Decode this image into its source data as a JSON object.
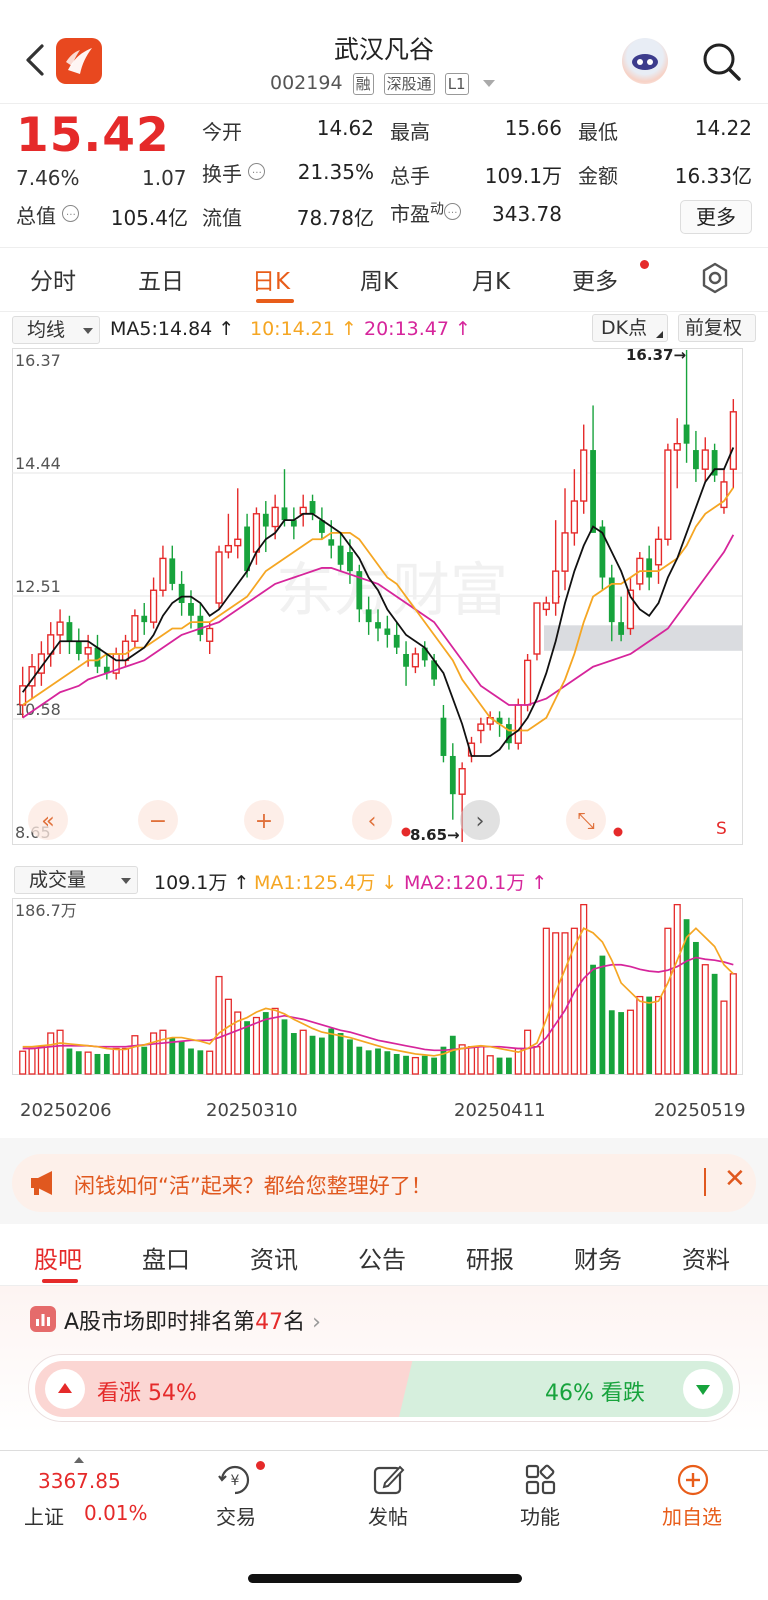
{
  "header": {
    "title": "武汉凡谷",
    "code": "002194",
    "tags": [
      "融",
      "深股通",
      "L1"
    ],
    "icons": {
      "back": "back-arrow-icon",
      "logo": "app-logo-icon",
      "robot": "ai-robot-icon",
      "search": "search-icon"
    }
  },
  "quote": {
    "price": "15.42",
    "change_pct": "7.46%",
    "change": "1.07",
    "open_label": "今开",
    "open": "14.62",
    "high_label": "最高",
    "high": "15.66",
    "low_label": "最低",
    "low": "14.22",
    "turnover_label": "换手",
    "turnover": "21.35%",
    "volume_label": "总手",
    "volume": "109.1万",
    "amount_label": "金额",
    "amount": "16.33亿",
    "mktcap_label": "总值",
    "mktcap": "105.4亿",
    "float_label": "流值",
    "float": "78.78亿",
    "pe_label": "市盈",
    "pe_sup": "动",
    "pe": "343.78",
    "more_label": "更多",
    "colors": {
      "up": "#e52a2a",
      "down": "#17a33c"
    }
  },
  "ktabs": {
    "items": [
      "分时",
      "五日",
      "日K",
      "周K",
      "月K",
      "更多"
    ],
    "active": "日K",
    "accent": "#e85d1a"
  },
  "ma_row": {
    "selector": "均线",
    "ma5": "MA5:14.84",
    "ma10": "10:14.21",
    "ma20": "20:13.47",
    "dk": "DK点",
    "adjust": "前复权",
    "colors": {
      "ma5": "#111111",
      "ma10": "#f5a623",
      "ma20": "#d6259b"
    }
  },
  "chart_data": [
    {
      "type": "candlestick",
      "y_ticks": [
        "16.37",
        "14.44",
        "12.51",
        "10.58",
        "8.65"
      ],
      "ylim": [
        8.65,
        16.37
      ],
      "annotations": {
        "high_marker": "16.37→",
        "low_marker": "8.65→",
        "s_marker": "S"
      },
      "watermark": "东方财富",
      "candles": [
        [
          10.8,
          11.4,
          10.6,
          11.1
        ],
        [
          11.1,
          11.6,
          10.9,
          11.4
        ],
        [
          11.3,
          11.8,
          11.1,
          11.6
        ],
        [
          11.6,
          12.1,
          11.4,
          11.9
        ],
        [
          11.9,
          12.3,
          11.6,
          12.1
        ],
        [
          12.1,
          12.2,
          11.6,
          11.8
        ],
        [
          11.8,
          12.0,
          11.5,
          11.6
        ],
        [
          11.6,
          11.9,
          11.4,
          11.7
        ],
        [
          11.7,
          11.9,
          11.3,
          11.4
        ],
        [
          11.4,
          11.6,
          11.2,
          11.3
        ],
        [
          11.3,
          11.7,
          11.2,
          11.6
        ],
        [
          11.5,
          11.9,
          11.4,
          11.8
        ],
        [
          11.8,
          12.3,
          11.7,
          12.2
        ],
        [
          12.2,
          12.4,
          11.9,
          12.1
        ],
        [
          12.1,
          12.8,
          12.0,
          12.6
        ],
        [
          12.6,
          13.3,
          12.5,
          13.1
        ],
        [
          13.1,
          13.3,
          12.6,
          12.7
        ],
        [
          12.7,
          12.9,
          12.2,
          12.4
        ],
        [
          12.4,
          12.6,
          12.0,
          12.2
        ],
        [
          12.2,
          12.4,
          11.8,
          11.9
        ],
        [
          11.8,
          12.1,
          11.6,
          12.0
        ],
        [
          12.4,
          13.3,
          12.3,
          13.2
        ],
        [
          13.2,
          13.8,
          13.1,
          13.3
        ],
        [
          13.3,
          14.2,
          13.1,
          13.4
        ],
        [
          13.6,
          13.8,
          12.8,
          12.9
        ],
        [
          13.2,
          13.9,
          13.0,
          13.8
        ],
        [
          13.8,
          14.0,
          13.2,
          13.6
        ],
        [
          13.6,
          14.1,
          13.4,
          13.9
        ],
        [
          13.9,
          14.5,
          13.6,
          13.7
        ],
        [
          13.7,
          13.9,
          13.4,
          13.6
        ],
        [
          13.8,
          14.1,
          13.6,
          13.9
        ],
        [
          14.0,
          14.1,
          13.7,
          13.8
        ],
        [
          13.7,
          13.9,
          13.4,
          13.5
        ],
        [
          13.4,
          13.7,
          13.1,
          13.3
        ],
        [
          13.3,
          13.5,
          12.9,
          13.0
        ],
        [
          13.2,
          13.4,
          12.7,
          12.9
        ],
        [
          12.9,
          13.0,
          12.1,
          12.3
        ],
        [
          12.3,
          12.5,
          11.9,
          12.1
        ],
        [
          12.1,
          12.3,
          11.8,
          12.0
        ],
        [
          12.0,
          12.2,
          11.7,
          11.9
        ],
        [
          11.9,
          12.1,
          11.6,
          11.7
        ],
        [
          11.6,
          11.8,
          11.1,
          11.4
        ],
        [
          11.4,
          11.7,
          11.3,
          11.6
        ],
        [
          11.7,
          11.8,
          11.4,
          11.5
        ],
        [
          11.5,
          11.6,
          11.1,
          11.2
        ],
        [
          10.6,
          10.8,
          9.9,
          10.0
        ],
        [
          10.0,
          10.2,
          9.0,
          9.4
        ],
        [
          9.4,
          9.9,
          8.65,
          9.8
        ],
        [
          10.0,
          10.3,
          9.9,
          10.2
        ],
        [
          10.4,
          10.6,
          10.2,
          10.5
        ],
        [
          10.5,
          10.7,
          10.4,
          10.6
        ],
        [
          10.6,
          10.7,
          10.3,
          10.5
        ],
        [
          10.5,
          10.6,
          10.1,
          10.2
        ],
        [
          10.2,
          10.9,
          10.1,
          10.8
        ],
        [
          10.8,
          11.6,
          10.7,
          11.5
        ],
        [
          11.6,
          12.4,
          11.5,
          12.4
        ],
        [
          12.3,
          12.5,
          12.2,
          12.4
        ],
        [
          12.4,
          13.7,
          12.2,
          12.9
        ],
        [
          12.9,
          14.2,
          12.6,
          13.5
        ],
        [
          13.5,
          14.5,
          13.3,
          14.0
        ],
        [
          14.0,
          15.2,
          13.8,
          14.8
        ],
        [
          14.8,
          15.5,
          13.7,
          13.5
        ],
        [
          13.6,
          13.7,
          12.6,
          12.8
        ],
        [
          12.8,
          13.0,
          11.8,
          12.1
        ],
        [
          12.1,
          12.5,
          11.8,
          11.9
        ],
        [
          12.0,
          12.8,
          11.9,
          12.6
        ],
        [
          12.7,
          13.2,
          12.6,
          13.1
        ],
        [
          13.1,
          13.3,
          12.6,
          12.8
        ],
        [
          13.0,
          13.6,
          12.7,
          13.4
        ],
        [
          13.4,
          14.9,
          13.3,
          14.8
        ],
        [
          14.8,
          15.3,
          14.2,
          14.9
        ],
        [
          15.2,
          16.37,
          14.6,
          14.9
        ],
        [
          14.8,
          15.1,
          14.3,
          14.5
        ],
        [
          14.5,
          15.0,
          14.3,
          14.8
        ],
        [
          14.8,
          14.9,
          14.3,
          14.4
        ],
        [
          13.9,
          14.5,
          13.8,
          14.3
        ],
        [
          14.5,
          15.6,
          14.2,
          15.4
        ]
      ],
      "ma5": [
        11.0,
        11.2,
        11.4,
        11.6,
        11.8,
        11.8,
        11.8,
        11.8,
        11.7,
        11.6,
        11.5,
        11.5,
        11.6,
        11.7,
        11.9,
        12.2,
        12.4,
        12.5,
        12.5,
        12.4,
        12.2,
        12.3,
        12.5,
        12.7,
        12.9,
        13.2,
        13.4,
        13.5,
        13.7,
        13.7,
        13.8,
        13.8,
        13.7,
        13.6,
        13.5,
        13.3,
        13.1,
        12.8,
        12.6,
        12.3,
        12.1,
        11.9,
        11.8,
        11.7,
        11.5,
        11.3,
        10.9,
        10.5,
        10.0,
        10.0,
        10.0,
        10.1,
        10.3,
        10.4,
        10.6,
        10.9,
        11.3,
        11.8,
        12.4,
        12.9,
        13.3,
        13.6,
        13.5,
        13.2,
        12.9,
        12.5,
        12.3,
        12.2,
        12.4,
        12.8,
        13.1,
        13.5,
        13.9,
        14.3,
        14.5,
        14.5,
        14.84
      ],
      "ma10": [
        10.8,
        10.9,
        11.0,
        11.1,
        11.2,
        11.3,
        11.4,
        11.5,
        11.5,
        11.6,
        11.6,
        11.6,
        11.7,
        11.7,
        11.8,
        11.9,
        12.0,
        12.0,
        12.1,
        12.1,
        12.1,
        12.2,
        12.3,
        12.4,
        12.5,
        12.7,
        12.9,
        13.0,
        13.1,
        13.2,
        13.3,
        13.4,
        13.4,
        13.5,
        13.5,
        13.5,
        13.4,
        13.2,
        13.0,
        12.8,
        12.7,
        12.5,
        12.3,
        12.1,
        11.9,
        11.7,
        11.5,
        11.2,
        11.0,
        10.8,
        10.6,
        10.5,
        10.4,
        10.4,
        10.4,
        10.5,
        10.6,
        10.9,
        11.2,
        11.6,
        12.1,
        12.5,
        12.6,
        12.7,
        12.7,
        12.8,
        12.9,
        12.9,
        12.9,
        13.0,
        13.1,
        13.3,
        13.6,
        13.8,
        13.9,
        14.0,
        14.21
      ],
      "ma20": [
        10.6,
        10.7,
        10.8,
        10.9,
        11.0,
        11.05,
        11.1,
        11.2,
        11.25,
        11.3,
        11.35,
        11.4,
        11.45,
        11.5,
        11.6,
        11.7,
        11.8,
        11.9,
        11.95,
        12.0,
        12.05,
        12.1,
        12.2,
        12.3,
        12.4,
        12.5,
        12.6,
        12.7,
        12.75,
        12.8,
        12.85,
        12.9,
        12.95,
        12.95,
        12.9,
        12.85,
        12.8,
        12.75,
        12.7,
        12.6,
        12.5,
        12.4,
        12.3,
        12.2,
        12.1,
        11.9,
        11.7,
        11.5,
        11.3,
        11.1,
        11.0,
        10.9,
        10.8,
        10.8,
        10.8,
        10.85,
        10.9,
        11.0,
        11.1,
        11.2,
        11.3,
        11.4,
        11.45,
        11.5,
        11.55,
        11.6,
        11.7,
        11.8,
        11.9,
        12.0,
        12.2,
        12.4,
        12.6,
        12.8,
        13.0,
        13.2,
        13.47
      ]
    },
    {
      "type": "bar",
      "title": "成交量",
      "max_label": "186.7万",
      "ylim": [
        0,
        186.7
      ],
      "x_tick_labels": [
        "20250206",
        "20250310",
        "20250411",
        "20250519"
      ],
      "values": [
        25,
        28,
        30,
        45,
        48,
        28,
        25,
        24,
        22,
        22,
        28,
        28,
        42,
        30,
        45,
        48,
        40,
        36,
        28,
        26,
        25,
        107,
        82,
        68,
        58,
        62,
        68,
        72,
        60,
        45,
        48,
        42,
        40,
        50,
        45,
        38,
        30,
        26,
        28,
        25,
        22,
        20,
        18,
        20,
        18,
        30,
        42,
        32,
        30,
        30,
        20,
        18,
        18,
        28,
        48,
        30,
        160,
        155,
        155,
        160,
        186,
        120,
        130,
        70,
        68,
        70,
        85,
        85,
        85,
        160,
        186,
        170,
        145,
        120,
        110,
        80,
        110
      ],
      "ma1": [
        30,
        30,
        31,
        32,
        34,
        33,
        32,
        31,
        30,
        28,
        27,
        27,
        30,
        32,
        35,
        38,
        40,
        40,
        38,
        36,
        33,
        45,
        52,
        58,
        62,
        68,
        72,
        70,
        66,
        60,
        55,
        50,
        46,
        44,
        42,
        40,
        37,
        34,
        31,
        28,
        26,
        24,
        22,
        21,
        20,
        22,
        26,
        28,
        30,
        31,
        30,
        28,
        26,
        24,
        28,
        34,
        60,
        90,
        115,
        140,
        160,
        155,
        145,
        125,
        100,
        90,
        80,
        78,
        80,
        100,
        125,
        150,
        160,
        150,
        140,
        120,
        110
      ],
      "ma2": [
        28,
        28,
        29,
        30,
        31,
        31,
        31,
        31,
        30,
        30,
        30,
        30,
        31,
        32,
        33,
        34,
        35,
        36,
        37,
        37,
        37,
        40,
        44,
        48,
        52,
        56,
        60,
        62,
        64,
        62,
        60,
        57,
        54,
        51,
        48,
        46,
        43,
        40,
        37,
        35,
        33,
        31,
        29,
        27,
        26,
        26,
        27,
        28,
        29,
        30,
        30,
        30,
        29,
        28,
        28,
        30,
        40,
        55,
        70,
        90,
        105,
        115,
        118,
        120,
        120,
        118,
        115,
        113,
        112,
        114,
        118,
        124,
        128,
        126,
        125,
        123,
        120.1
      ]
    }
  ],
  "vol_row": {
    "selector": "成交量",
    "vol": "109.1万",
    "ma1": "MA1:125.4万",
    "ma2": "MA2:120.1万"
  },
  "chart_controls": [
    "fast-backward-icon",
    "zoom-out-icon",
    "zoom-in-icon",
    "step-back-icon",
    "step-forward-icon",
    "fullscreen-icon"
  ],
  "banner": {
    "text": "闲钱如何“活”起来？都给您整理好了！",
    "icon": "megaphone-icon"
  },
  "btabs": {
    "items": [
      "股吧",
      "盘口",
      "资讯",
      "公告",
      "研报",
      "财务",
      "资料"
    ],
    "active": "股吧"
  },
  "community": {
    "rank_prefix": "A股市场即时排名第",
    "rank_num": "47",
    "rank_suffix": "名",
    "bull_label": "看涨 54%",
    "bear_label": "46% 看跌",
    "bull_pct": 54,
    "bear_pct": 46
  },
  "nav": {
    "index_value": "3367.85",
    "index_name": "上证",
    "index_change": "0.01%",
    "items": [
      {
        "label": "交易",
        "icon": "yuan-trade-icon"
      },
      {
        "label": "发帖",
        "icon": "edit-post-icon"
      },
      {
        "label": "功能",
        "icon": "grid-apps-icon"
      },
      {
        "label": "加自选",
        "icon": "add-watchlist-icon"
      }
    ]
  }
}
